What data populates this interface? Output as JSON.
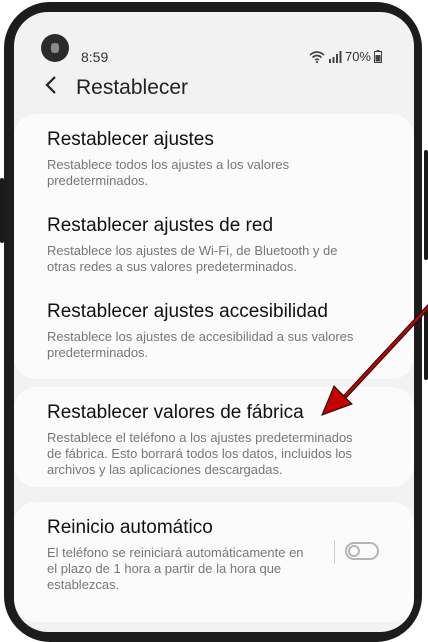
{
  "status_bar": {
    "time": "8:59",
    "battery": "70%"
  },
  "header": {
    "title": "Restablecer"
  },
  "items": [
    {
      "title": "Restablecer ajustes",
      "description": "Restablece todos los ajustes a los valores predeterminados."
    },
    {
      "title": "Restablecer ajustes de red",
      "description": "Restablece los ajustes de Wi-Fi, de Bluetooth y de otras redes a sus valores predeterminados."
    },
    {
      "title": "Restablecer ajustes accesibilidad",
      "description": "Restablece los ajustes de accesibilidad a sus valores predeterminados."
    },
    {
      "title": "Restablecer valores de fábrica",
      "description": "Restablece el teléfono a los ajustes predeterminados de fábrica. Esto borrará todos los datos, incluidos los archivos y las aplicaciones descargadas."
    },
    {
      "title": "Reinicio automático",
      "description": "El teléfono se reiniciará automáticamente en el plazo de 1 hora a partir de la hora que establezcas."
    }
  ],
  "auto_restart_toggle": {
    "on": false
  },
  "annotation": {
    "arrow_color": "#c40000",
    "target": "Restablecer valores de fábrica"
  },
  "colors": {
    "background": "#f2f2f2",
    "card": "#fbfbfb",
    "title_text": "#111111",
    "description_text": "#777777"
  }
}
